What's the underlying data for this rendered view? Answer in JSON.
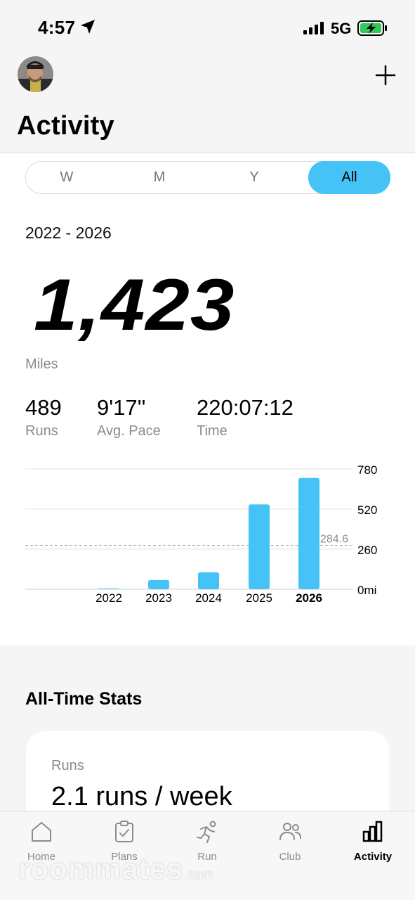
{
  "status": {
    "time": "4:57",
    "network": "5G"
  },
  "header": {
    "title": "Activity"
  },
  "segments": [
    "W",
    "M",
    "Y",
    "All"
  ],
  "active_segment": "All",
  "range": "2022 - 2026",
  "total": {
    "value": "1,423",
    "unit": "Miles"
  },
  "stats": [
    {
      "value": "489",
      "label": "Runs"
    },
    {
      "value": "9'17''",
      "label": "Avg. Pace"
    },
    {
      "value": "220:07:12",
      "label": "Time"
    }
  ],
  "chart_data": {
    "type": "bar",
    "categories": [
      "2022",
      "2023",
      "2024",
      "2025",
      "2026"
    ],
    "values": [
      2,
      60,
      110,
      550,
      722
    ],
    "highlight_category": "2026",
    "y_ticks": [
      "780",
      "520",
      "260",
      "0mi"
    ],
    "ylim": [
      0,
      780
    ],
    "average": 284.6,
    "average_label": "284.6",
    "grid": true,
    "bar_color": "#45c3f6"
  },
  "all_time": {
    "title": "All-Time Stats",
    "card_label": "Runs",
    "card_value": "2.1 runs / week"
  },
  "tabs": [
    {
      "label": "Home",
      "icon": "home-icon"
    },
    {
      "label": "Plans",
      "icon": "clipboard-icon"
    },
    {
      "label": "Run",
      "icon": "runner-icon"
    },
    {
      "label": "Club",
      "icon": "people-icon"
    },
    {
      "label": "Activity",
      "icon": "bar-chart-icon"
    }
  ],
  "active_tab": "Activity",
  "watermark": {
    "brand": "roommates",
    "suffix": ".com"
  },
  "colors": {
    "accent": "#45c3f6",
    "muted": "#8c8c8c"
  }
}
